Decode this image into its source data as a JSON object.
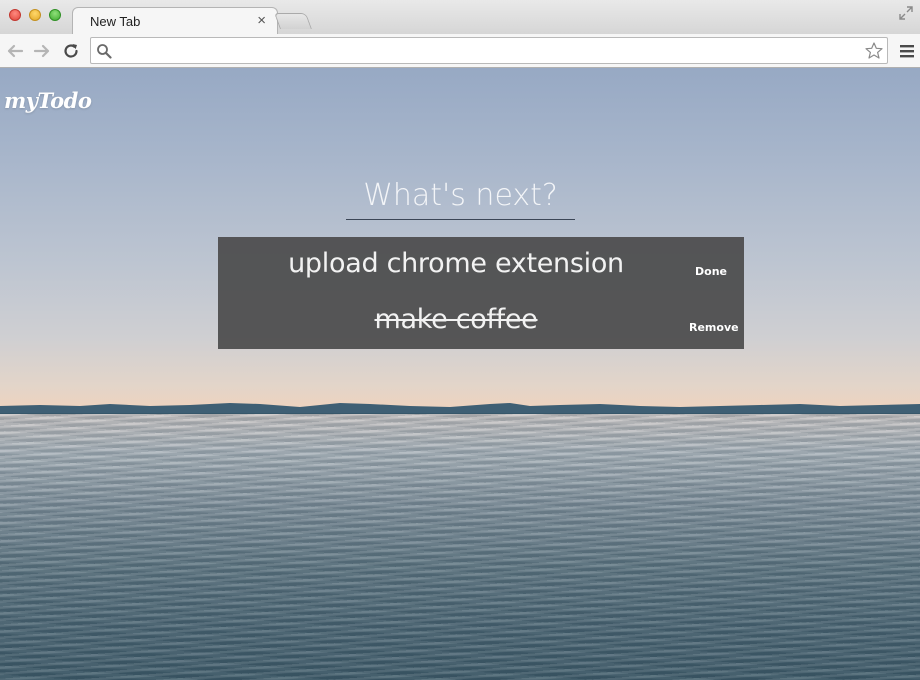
{
  "browser": {
    "tab_title": "New Tab",
    "tab_close": "×",
    "omnibox_value": ""
  },
  "app": {
    "logo": "myTodo",
    "input_placeholder": "What's next?",
    "todos": [
      {
        "text": "upload chrome extension",
        "completed": false,
        "action": "Done"
      },
      {
        "text": "make coffee",
        "completed": true,
        "action": "Remove"
      }
    ]
  },
  "colors": {
    "panel": "#4b4b4b",
    "sky_top": "#97a9c4",
    "sunset": "#f2c9b4",
    "water": "#4a6472"
  }
}
